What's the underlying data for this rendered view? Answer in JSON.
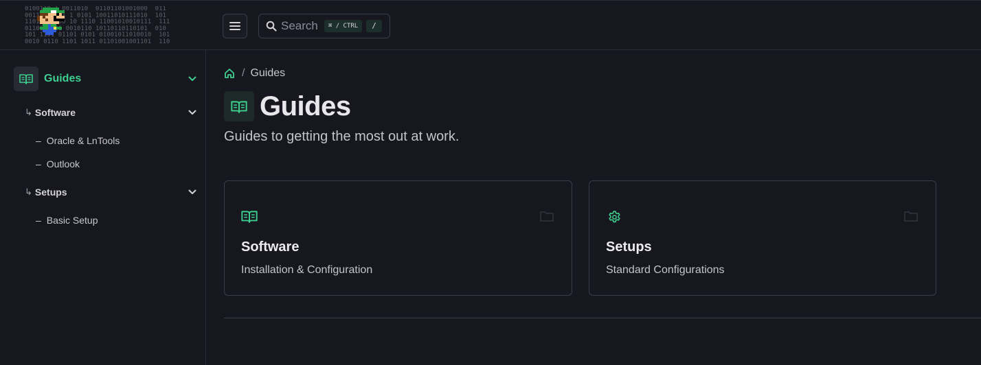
{
  "header": {
    "logo_binary": "0100110 1 0011010  01101101001000  011\n0011 101011 1 0101 10011010111010  101\n11011 00100 10 1110 11001010010111  111\n0110101101 0010110 10110110110101  010\n101 1101 01101 0101 01001011010010  101\n0010 0110 1101 1011 01101001001101  110",
    "search": {
      "placeholder": "Search",
      "shortcut": "⌘ / CTRL",
      "slash": "/"
    }
  },
  "sidebar": {
    "root": {
      "label": "Guides"
    },
    "sections": [
      {
        "label": "Software",
        "items": [
          "Oracle & LnTools",
          "Outlook"
        ]
      },
      {
        "label": "Setups",
        "items": [
          "Basic Setup"
        ]
      }
    ],
    "arrow": "↳",
    "dash": "–"
  },
  "breadcrumb": {
    "current": "Guides",
    "separator": "/"
  },
  "page": {
    "title": "Guides",
    "subtitle": "Guides to getting the most out at work."
  },
  "cards": [
    {
      "title": "Software",
      "description": "Installation & Configuration",
      "icon": "book-open-icon"
    },
    {
      "title": "Setups",
      "description": "Standard Configurations",
      "icon": "gear-icon"
    }
  ],
  "colors": {
    "accent": "#3ecf8e",
    "background": "#17181f",
    "border": "#3a3c46"
  }
}
